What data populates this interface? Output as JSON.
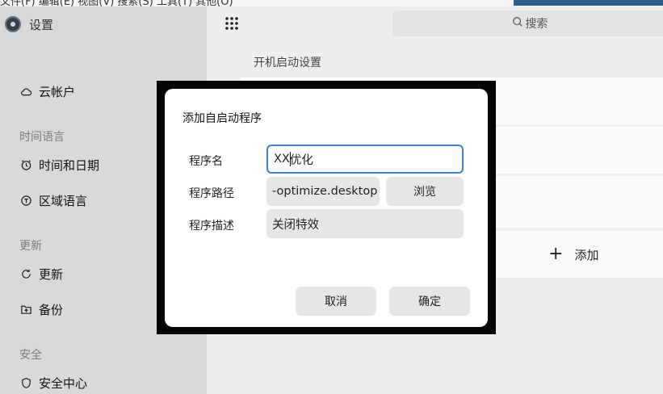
{
  "menubar": {
    "text": "文件(F)  编辑(E)  视图(V)  搜索(S)  工具(T)  其他(O)"
  },
  "app": {
    "title": "设置",
    "logo_icon": "settings-app-icon"
  },
  "sidebar": {
    "items": [
      {
        "label": "云帐户",
        "icon": "cloud-icon"
      },
      {
        "group": "时间语言"
      },
      {
        "label": "时间和日期",
        "icon": "clock-icon"
      },
      {
        "label": "区域语言",
        "icon": "language-icon"
      },
      {
        "group": "更新"
      },
      {
        "label": "更新",
        "icon": "refresh-icon"
      },
      {
        "label": "备份",
        "icon": "backup-icon"
      },
      {
        "group": "安全"
      },
      {
        "label": "安全中心",
        "icon": "shield-icon"
      }
    ]
  },
  "header": {
    "search_placeholder": "搜索",
    "menu_icon": "app-grid-icon"
  },
  "main": {
    "section_title": "开机启动设置",
    "add_label": "添加"
  },
  "dialog": {
    "title": "添加自启动程序",
    "name_label": "程序名",
    "name_value_before_caret": "XX",
    "name_value_after_caret": "优化",
    "path_label": "程序路径",
    "path_value": "-optimize.desktop",
    "browse_label": "浏览",
    "desc_label": "程序描述",
    "desc_value": "关闭特效",
    "cancel_label": "取消",
    "ok_label": "确定"
  },
  "colors": {
    "accent": "#3b82d4",
    "sidebar_bg": "#d9d9d9",
    "dialog_frame": "#050505"
  }
}
